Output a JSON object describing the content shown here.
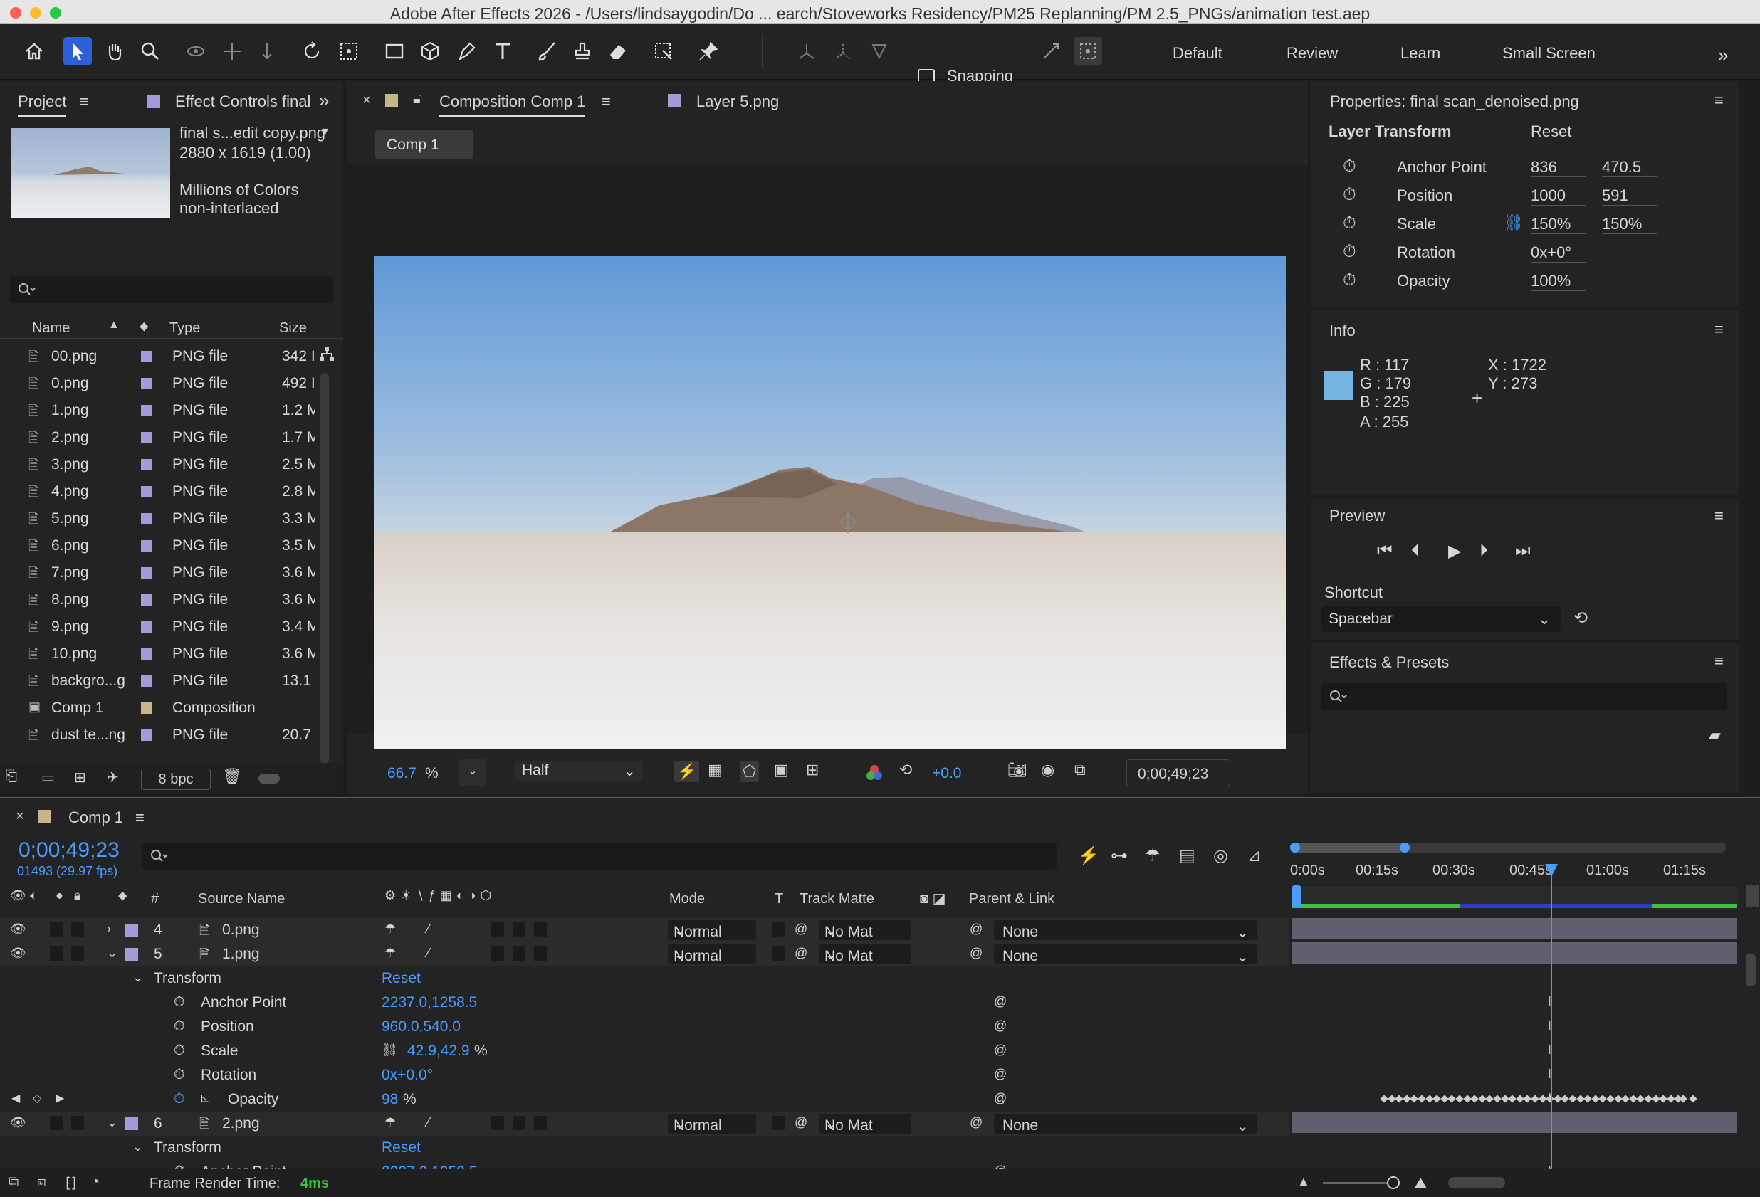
{
  "window": {
    "title": "Adobe After Effects 2026 - /Users/lindsaygodin/Do ... earch/Stoveworks Residency/PM25 Replanning/PM 2.5_PNGs/animation test.aep"
  },
  "toolbar": {
    "snapping_label": "Snapping",
    "workspaces": [
      "Default",
      "Review",
      "Learn",
      "Small Screen"
    ]
  },
  "project": {
    "tab_label": "Project",
    "effect_controls_label": "Effect Controls final",
    "thumb_name": "final s...edit copy.png",
    "thumb_dims": "2880 x 1619 (1.00)",
    "thumb_colors": "Millions of Colors",
    "thumb_interlace": "non-interlaced",
    "search_placeholder": "",
    "col_name": "Name",
    "col_type": "Type",
    "col_size": "Size",
    "items": [
      {
        "name": "00.png",
        "type": "PNG file",
        "size": "342 I"
      },
      {
        "name": "0.png",
        "type": "PNG file",
        "size": "492 I"
      },
      {
        "name": "1.png",
        "type": "PNG file",
        "size": "1.2 M"
      },
      {
        "name": "2.png",
        "type": "PNG file",
        "size": "1.7 M"
      },
      {
        "name": "3.png",
        "type": "PNG file",
        "size": "2.5 M"
      },
      {
        "name": "4.png",
        "type": "PNG file",
        "size": "2.8 M"
      },
      {
        "name": "5.png",
        "type": "PNG file",
        "size": "3.3 M"
      },
      {
        "name": "6.png",
        "type": "PNG file",
        "size": "3.5 M"
      },
      {
        "name": "7.png",
        "type": "PNG file",
        "size": "3.6 M"
      },
      {
        "name": "8.png",
        "type": "PNG file",
        "size": "3.6 M"
      },
      {
        "name": "9.png",
        "type": "PNG file",
        "size": "3.4 M"
      },
      {
        "name": "10.png",
        "type": "PNG file",
        "size": "3.6 M"
      },
      {
        "name": "backgro...g",
        "type": "PNG file",
        "size": "13.1"
      },
      {
        "name": "Comp 1",
        "type": "Composition",
        "size": ""
      },
      {
        "name": "dust te...ng",
        "type": "PNG file",
        "size": "20.7"
      }
    ],
    "bpc": "8 bpc"
  },
  "comp": {
    "tab_label": "Composition Comp 1",
    "layer_tab": "Layer 5.png",
    "breadcrumb": "Comp 1",
    "zoom": "66.7",
    "zoom_unit": "%",
    "resolution": "Half",
    "exposure": "+0.0",
    "timecode": "0;00;49;23"
  },
  "properties": {
    "title": "Properties: final scan_denoised.png",
    "section": "Layer Transform",
    "reset": "Reset",
    "anchor_label": "Anchor Point",
    "anchor_x": "836",
    "anchor_y": "470.5",
    "position_label": "Position",
    "position_x": "1000",
    "position_y": "591",
    "scale_label": "Scale",
    "scale_x": "150",
    "scale_y": "150",
    "pct": "%",
    "rotation_label": "Rotation",
    "rotation_val": "0x+0°",
    "opacity_label": "Opacity",
    "opacity_val": "100"
  },
  "info": {
    "title": "Info",
    "r": "R :  117",
    "g": "G :  179",
    "b": "B :  225",
    "a": "A :  255",
    "x": "X : 1722",
    "y": "Y :  273",
    "swatch": "#75b3e1"
  },
  "preview": {
    "title": "Preview",
    "shortcut_label": "Shortcut",
    "shortcut_value": "Spacebar"
  },
  "effects": {
    "title": "Effects & Presets"
  },
  "timeline": {
    "tab_label": "Comp 1",
    "timecode": "0;00;49;23",
    "frames": "01493 (29.97 fps)",
    "col_hash": "#",
    "col_source": "Source Name",
    "col_mode": "Mode",
    "col_t": "T",
    "col_matte": "Track Matte",
    "col_parent": "Parent & Link",
    "ruler": [
      "0:00s",
      "00:15s",
      "00:30s",
      "00:45s",
      "01:00s",
      "01:15s"
    ],
    "layer4": {
      "num": "4",
      "name": "0.png",
      "mode": "Normal",
      "matte": "No Mat",
      "parent": "None"
    },
    "layer5": {
      "num": "5",
      "name": "1.png",
      "mode": "Normal",
      "matte": "No Mat",
      "parent": "None"
    },
    "layer6": {
      "num": "6",
      "name": "2.png",
      "mode": "Normal",
      "matte": "No Mat",
      "parent": "None"
    },
    "transform": "Transform",
    "reset": "Reset",
    "anchor_label": "Anchor Point",
    "anchor_val": "2237.0,1258.5",
    "position_label": "Position",
    "position_val": "960.0,540.0",
    "scale_label": "Scale",
    "scale_val": "42.9,42.9",
    "pct": "%",
    "rotation_label": "Rotation",
    "rotation_val": "0x+0.0°",
    "opacity_label": "Opacity",
    "opacity_val": "98",
    "render_label": "Frame Render Time:",
    "render_val": "4ms"
  },
  "colors": {
    "accent": "#2d5fd8",
    "link_blue": "#4a9dff",
    "playhead": "#4a9dff",
    "render_green": "#40c040"
  }
}
